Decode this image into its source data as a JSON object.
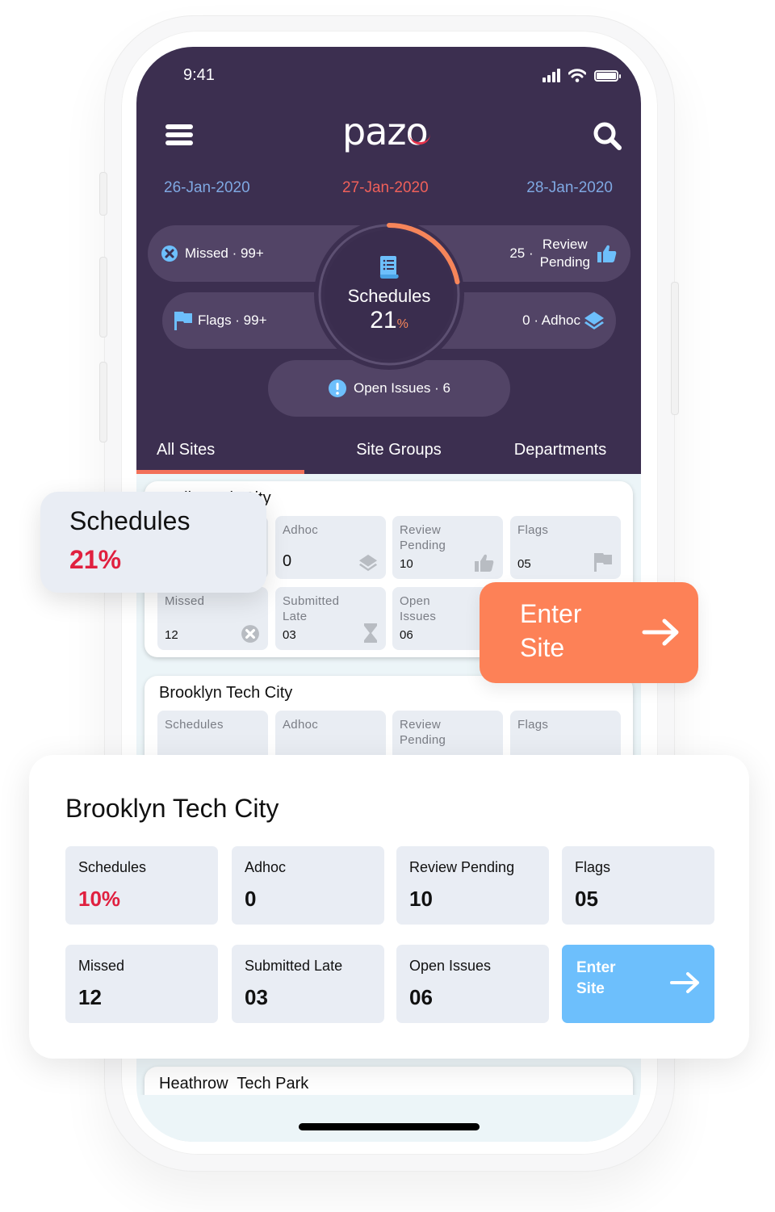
{
  "status_bar": {
    "time": "9:41"
  },
  "header": {
    "logo": "paz",
    "logo_last": "o",
    "dates": {
      "prev": "26-Jan-2020",
      "current": "27-Jan-2020",
      "next": "28-Jan-2020"
    }
  },
  "summary": {
    "missed": "Missed · 99+",
    "review_count": "25 ·",
    "review_label_1": "Review",
    "review_label_2": "Pending",
    "flags": "Flags · 99+",
    "adhoc": "0 · Adhoc",
    "open_issues": "Open Issues · 6",
    "gauge": {
      "label": "Schedules",
      "value": "21",
      "unit": "%",
      "progress": 0.21
    }
  },
  "colors": {
    "header_bg": "#3c2f50",
    "accent_orange": "#f2715a",
    "accent_blue": "#6dbffc",
    "schedule_red": "#e0203f"
  },
  "tabs": [
    {
      "label": "All Sites",
      "active": true
    },
    {
      "label": "Site Groups",
      "active": false
    },
    {
      "label": "Departments",
      "active": false
    }
  ],
  "site_cards": [
    {
      "title": "Berlin Tech City",
      "stats": [
        {
          "label": "Schedules",
          "value": "21%",
          "icon": "schedule-icon"
        },
        {
          "label": "Adhoc",
          "value": "0",
          "icon": "layers-icon"
        },
        {
          "label": "Review Pending",
          "value": "10",
          "icon": "thumbs-up-icon"
        },
        {
          "label": "Flags",
          "value": "05",
          "icon": "flag-icon"
        },
        {
          "label": "Missed",
          "value": "12",
          "icon": "x-circle-icon"
        },
        {
          "label": "Submitted Late",
          "value": "03",
          "icon": "hourglass-icon"
        },
        {
          "label": "Open Issues",
          "value": "06",
          "icon": "alert-icon"
        }
      ]
    },
    {
      "title": "Brooklyn Tech City",
      "stats": [
        {
          "label": "Schedules",
          "icon": "schedule-icon"
        },
        {
          "label": "Adhoc",
          "icon": "layers-icon"
        },
        {
          "label": "Review Pending",
          "icon": "thumbs-up-icon"
        },
        {
          "label": "Flags",
          "icon": "flag-icon"
        }
      ]
    },
    {
      "title": "Heathrow  Tech Park"
    }
  ],
  "schedules_callout": {
    "label": "Schedules",
    "value": "21%"
  },
  "enter_site_orange": {
    "label": "Enter Site"
  },
  "expanded_card": {
    "title": "Brooklyn Tech City",
    "stats": [
      {
        "label": "Schedules",
        "value": "10%"
      },
      {
        "label": "Adhoc",
        "value": "0"
      },
      {
        "label": "Review Pending",
        "value": "10"
      },
      {
        "label": "Flags",
        "value": "05"
      },
      {
        "label": "Missed",
        "value": "12"
      },
      {
        "label": "Submitted Late",
        "value": "03"
      },
      {
        "label": "Open Issues",
        "value": "06"
      }
    ],
    "enter_label": "Enter Site"
  }
}
